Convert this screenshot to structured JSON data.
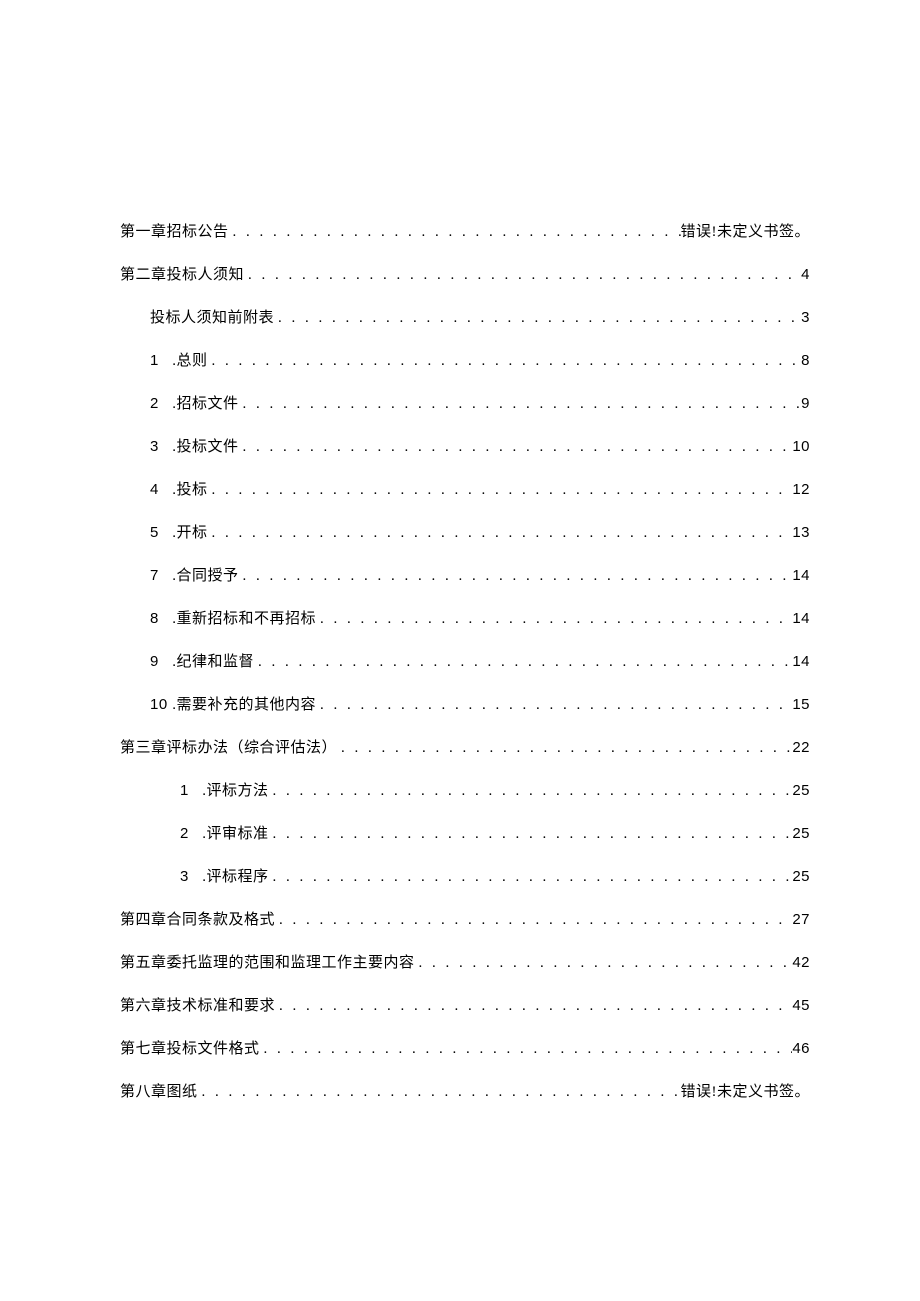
{
  "toc": [
    {
      "indent": 0,
      "num": "",
      "title": "第一章招标公告",
      "page": "错误!未定义书签。"
    },
    {
      "indent": 0,
      "num": "",
      "title": "第二章投标人须知",
      "page": "4"
    },
    {
      "indent": 1,
      "num": "",
      "title": "投标人须知前附表",
      "page": "3"
    },
    {
      "indent": 2,
      "num": "1",
      "title": ".总则",
      "page": "8"
    },
    {
      "indent": 2,
      "num": "2",
      "title": ".招标文件",
      "page": "9"
    },
    {
      "indent": 2,
      "num": "3",
      "title": ".投标文件",
      "page": "10"
    },
    {
      "indent": 2,
      "num": "4",
      "title": ".投标",
      "page": "12"
    },
    {
      "indent": 2,
      "num": "5",
      "title": ".开标",
      "page": "13"
    },
    {
      "indent": 2,
      "num": "7",
      "title": ".合同授予",
      "page": "14"
    },
    {
      "indent": 2,
      "num": "8",
      "title": ".重新招标和不再招标",
      "page": "14"
    },
    {
      "indent": 2,
      "num": "9",
      "title": ".纪律和监督",
      "page": "14"
    },
    {
      "indent": 2,
      "num": "10",
      "title": ".需要补充的其他内容",
      "page": "15"
    },
    {
      "indent": 0,
      "num": "",
      "title": "第三章评标办法（综合评估法）",
      "page": "22"
    },
    {
      "indent": 3,
      "num": "1",
      "title": ".评标方法",
      "page": "25"
    },
    {
      "indent": 3,
      "num": "2",
      "title": ".评审标准",
      "page": "25"
    },
    {
      "indent": 3,
      "num": "3",
      "title": ".评标程序",
      "page": "25"
    },
    {
      "indent": 0,
      "num": "",
      "title": "第四章合同条款及格式",
      "page": "27"
    },
    {
      "indent": 0,
      "num": "",
      "title": "第五章委托监理的范围和监理工作主要内容",
      "page": "42"
    },
    {
      "indent": 0,
      "num": "",
      "title": "第六章技术标准和要求",
      "page": "45"
    },
    {
      "indent": 0,
      "num": "",
      "title": "第七章投标文件格式",
      "page": "46"
    },
    {
      "indent": 0,
      "num": "",
      "title": "第八章图纸",
      "page": "错误!未定义书签。"
    }
  ]
}
